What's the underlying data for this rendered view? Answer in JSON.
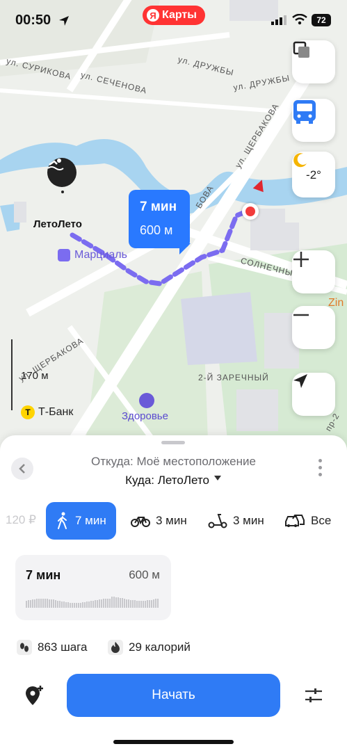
{
  "status_bar": {
    "time": "00:50",
    "battery": "72"
  },
  "app_badge": {
    "ya": "Я",
    "title": "Карты"
  },
  "map": {
    "streets": {
      "druzhby_1": "ул. ДРУЖБЫ",
      "druzhby_2": "ул. ДРУЖБЫ",
      "surikova": "ул. СУРИКОВА",
      "sechenova": "ул. СЕЧЕНОВА",
      "scherbakova_1": "ул. ЩЕРБАКОВА",
      "scherbakova_2": "ул. ЩЕРБАКОВА",
      "scherbakova_3": "ул. ЩЕРБАКОВА",
      "solnechny": "СОЛНЕЧНЫЙ",
      "zarechny": "2-Й ЗАРЕЧНЫЙ",
      "bova": "БОВА",
      "pr2": "пр-2"
    },
    "pois": {
      "leto_leto": "ЛетоЛето",
      "martsial": "Марциаль",
      "tbank": "Т-Банк",
      "zdorovye": "Здоровье",
      "zin": "Zin"
    },
    "scale": "170 м",
    "weather_temp": "-2°",
    "route_bubble": {
      "time": "7 мин",
      "distance": "600 м"
    },
    "route_color": "#7b6cf0",
    "water_color": "#a8d4f0",
    "park_color": "#cfe6cf"
  },
  "sheet": {
    "from": "Откуда: Моё местоположение",
    "to": "Куда: ЛетоЛето",
    "price_partial": "120 ₽",
    "modes": [
      {
        "label": "7 мин",
        "icon": "walk-icon"
      },
      {
        "label": "3 мин",
        "icon": "bike-icon"
      },
      {
        "label": "3 мин",
        "icon": "scooter-icon"
      },
      {
        "label": "Все",
        "icon": "cars-icon"
      }
    ],
    "route_card": {
      "time": "7 мин",
      "distance": "600 м"
    },
    "steps": "863 шага",
    "calories": "29 калорий",
    "start_label": "Начать"
  },
  "colors": {
    "accent": "#2f7bf5",
    "brand_red": "#ff3333"
  }
}
